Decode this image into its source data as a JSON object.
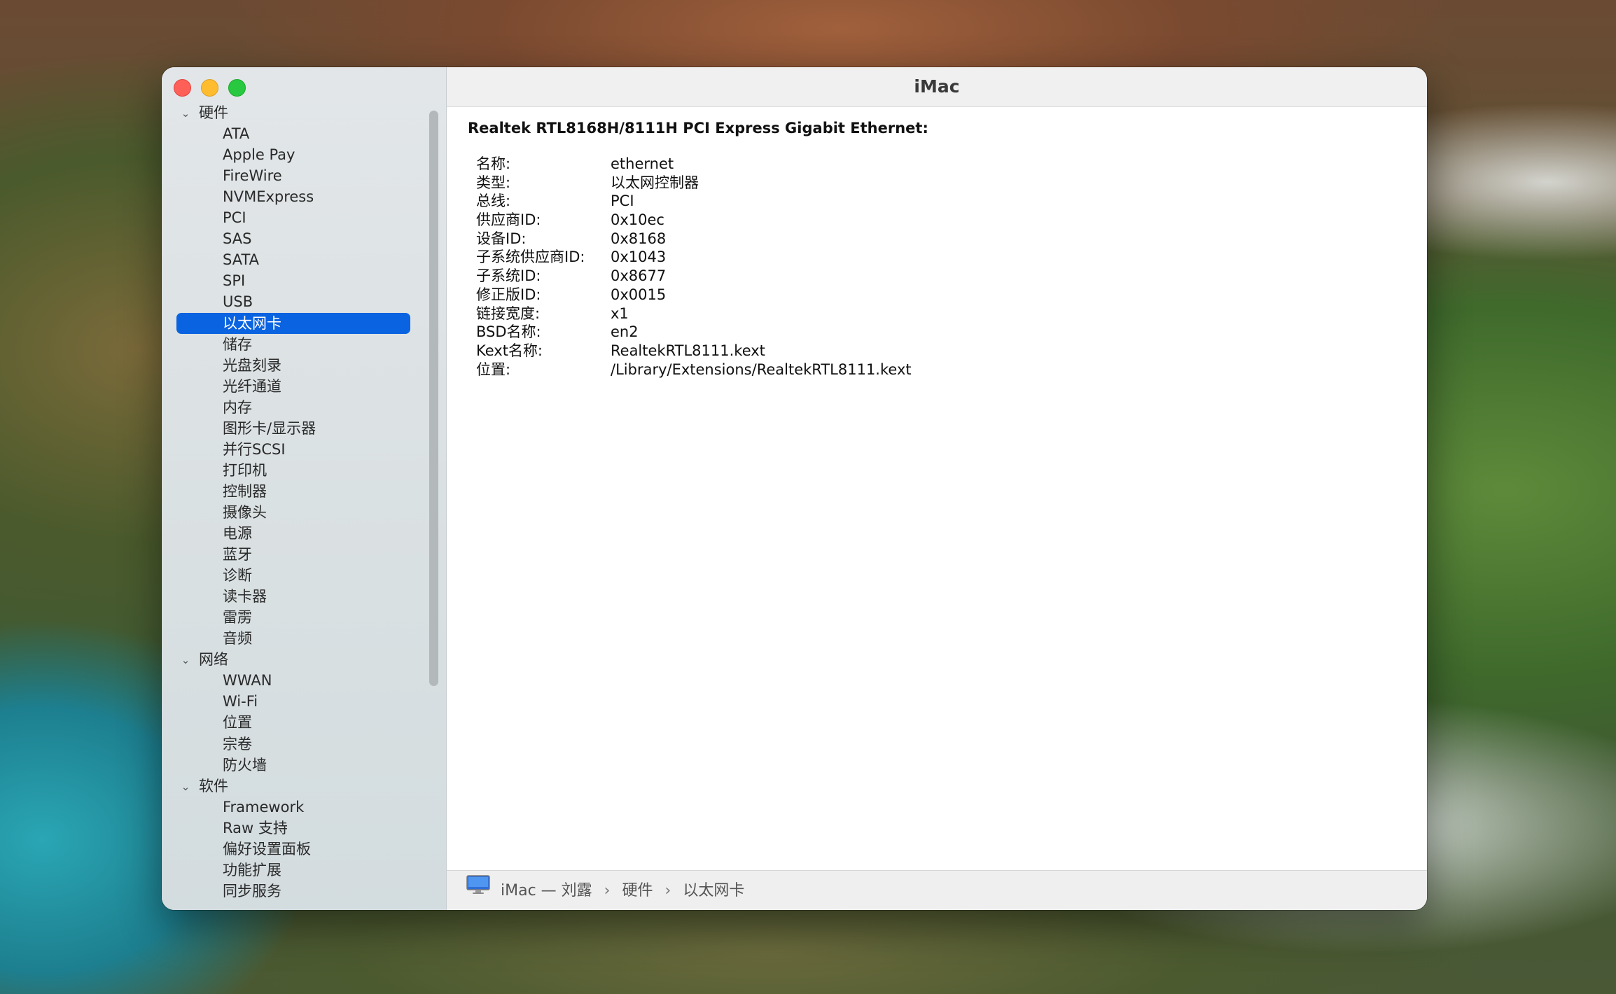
{
  "window": {
    "title": "iMac",
    "accent_color": "#0a63e0"
  },
  "sidebar": {
    "groups": [
      {
        "label": "硬件",
        "items": [
          "ATA",
          "Apple Pay",
          "FireWire",
          "NVMExpress",
          "PCI",
          "SAS",
          "SATA",
          "SPI",
          "USB",
          "以太网卡",
          "储存",
          "光盘刻录",
          "光纤通道",
          "内存",
          "图形卡/显示器",
          "并行SCSI",
          "打印机",
          "控制器",
          "摄像头",
          "电源",
          "蓝牙",
          "诊断",
          "读卡器",
          "雷雳",
          "音频"
        ]
      },
      {
        "label": "网络",
        "items": [
          "WWAN",
          "Wi-Fi",
          "位置",
          "宗卷",
          "防火墙"
        ]
      },
      {
        "label": "软件",
        "items": [
          "Framework",
          "Raw 支持",
          "偏好设置面板",
          "功能扩展",
          "同步服务"
        ]
      }
    ],
    "selected": "以太网卡"
  },
  "detail": {
    "heading": "Realtek RTL8168H/8111H PCI Express Gigabit Ethernet:",
    "properties": [
      {
        "key": "名称:",
        "value": "ethernet"
      },
      {
        "key": "类型:",
        "value": "以太网控制器"
      },
      {
        "key": "总线:",
        "value": "PCI"
      },
      {
        "key": "供应商ID:",
        "value": "0x10ec"
      },
      {
        "key": "设备ID:",
        "value": "0x8168"
      },
      {
        "key": "子系统供应商ID:",
        "value": "0x1043"
      },
      {
        "key": "子系统ID:",
        "value": "0x8677"
      },
      {
        "key": "修正版ID:",
        "value": "0x0015"
      },
      {
        "key": "链接宽度:",
        "value": "x1"
      },
      {
        "key": "BSD名称:",
        "value": "en2"
      },
      {
        "key": "Kext名称:",
        "value": "RealtekRTL8111.kext"
      },
      {
        "key": "位置:",
        "value": "/Library/Extensions/RealtekRTL8111.kext"
      }
    ]
  },
  "statusbar": {
    "computer": "iMac — 刘露",
    "crumbs": [
      "硬件",
      "以太网卡"
    ],
    "icon": "imac-icon"
  }
}
